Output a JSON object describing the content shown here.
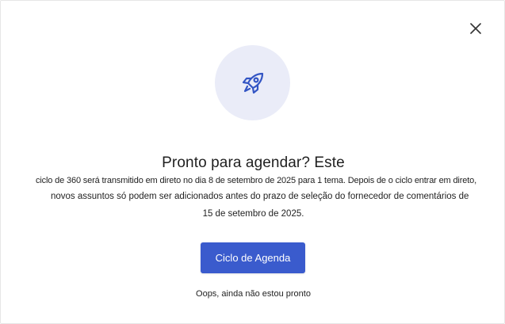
{
  "dialog": {
    "close_label": "×",
    "icon": "rocket-icon",
    "title": "Pronto para agendar? Este",
    "description_lines": [
      "ciclo de 360 será transmitido em direto no dia 8 de setembro de 2025 para 1 tema. Depois de o ciclo entrar em direto,",
      "novos assuntos só podem ser adicionados antes do prazo de seleção do fornecedor de comentários de",
      "15 de setembro de 2025."
    ],
    "primary_button": "Ciclo de Agenda",
    "secondary_link": "Oops, ainda não estou pronto"
  },
  "colors": {
    "accent": "#3a5bcd",
    "icon_bg": "#eaecf8",
    "icon_stroke": "#3355c4",
    "text": "#1f1f1f"
  }
}
